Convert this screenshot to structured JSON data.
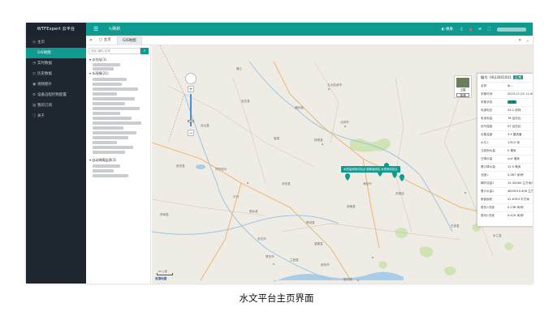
{
  "app": {
    "brand": "WTFExpert 云平台",
    "refresh_label": "刷新"
  },
  "topbar": {
    "icons": [
      "menu-icon",
      "refresh-icon",
      "theme-icon",
      "bell-icon",
      "message-icon",
      "fullscreen-icon"
    ],
    "theme_label": "换肤"
  },
  "colors": {
    "accent": "#0e9a8f",
    "sidebar_bg": "#1e2630",
    "alert": "#ff5a4a"
  },
  "sidebar": {
    "items": [
      {
        "label": "主页",
        "icon": "home-icon",
        "active": false
      },
      {
        "label": "GIS地图",
        "icon": "map-icon",
        "active": true,
        "sub": true
      },
      {
        "label": "实时数据",
        "icon": "realtime-icon",
        "active": false
      },
      {
        "label": "历史数据",
        "icon": "history-icon",
        "active": false
      },
      {
        "label": "视频图片",
        "icon": "camera-icon",
        "active": false
      },
      {
        "label": "设备远程控制配置",
        "icon": "settings-icon",
        "active": false
      },
      {
        "label": "我的订阅",
        "icon": "subscribe-icon",
        "active": false
      },
      {
        "label": "关于",
        "icon": "info-icon",
        "active": false
      }
    ]
  },
  "tabs": {
    "home": "主页",
    "gis": "GIS地图"
  },
  "tree": {
    "search_placeholder": "测站 编码/名称",
    "groups": [
      "水位站(1)",
      "水雨情(21)",
      "自动墒情监测(3)"
    ]
  },
  "map": {
    "place_labels": [
      "五大连池市",
      "北安市",
      "通北镇",
      "克东县",
      "宝泉",
      "拜泉县",
      "克山县",
      "依安县",
      "林甸县",
      "庆安县",
      "绥棱县",
      "明水县",
      "青冈县",
      "望奎县",
      "兰西县",
      "绥化市",
      "海伦市",
      "苏家店",
      "齐齐哈尔",
      "中兴",
      "安达市",
      "肇东市",
      "哈尔滨",
      "铁力市",
      "巴彦县",
      "木兰县",
      "伊春",
      "嫩江"
    ],
    "layer_satellite": "卫星",
    "layer_standard": "普通",
    "station_popup": "水质监测测试站点 国家级测站 水质测试站点",
    "logo": "百度地图",
    "scale": "50 公里"
  },
  "info": {
    "code_label": "编号:",
    "code": "0023001001",
    "status": "正常",
    "rows": [
      {
        "k": "名称",
        "v": "水..."
      },
      {
        "k": "采集时间",
        "v": "2023-11-02 11:00:00"
      },
      {
        "k": "采集状态",
        "v": "正常",
        "badge": true
      },
      {
        "k": "电源电压",
        "v": "24.1 伏特"
      },
      {
        "k": "电池电量",
        "v": "76 百分比"
      },
      {
        "k": "信号强度",
        "v": "97 百分比"
      },
      {
        "k": "设备温度",
        "v": "3.5 摄氏度"
      },
      {
        "k": "水位1",
        "v": "1.612 米"
      },
      {
        "k": "当前雨水量",
        "v": "0 毫米"
      },
      {
        "k": "日降水量",
        "v": "null 毫米"
      },
      {
        "k": "累计降水量",
        "v": "12.5 毫米"
      },
      {
        "k": "流速1",
        "v": "0.367 米/秒"
      },
      {
        "k": "瞬时流量1",
        "v": "15.30364 立方米/秒"
      },
      {
        "k": "累计水量1",
        "v": "4825010.408 立方米"
      },
      {
        "k": "断面面积",
        "v": "41.6763 平方米"
      },
      {
        "k": "垂线1流速",
        "v": "0.238 米/秒"
      },
      {
        "k": "垂线2流速",
        "v": "0.429 米/秒"
      }
    ]
  },
  "caption": "水文平台主页界面"
}
